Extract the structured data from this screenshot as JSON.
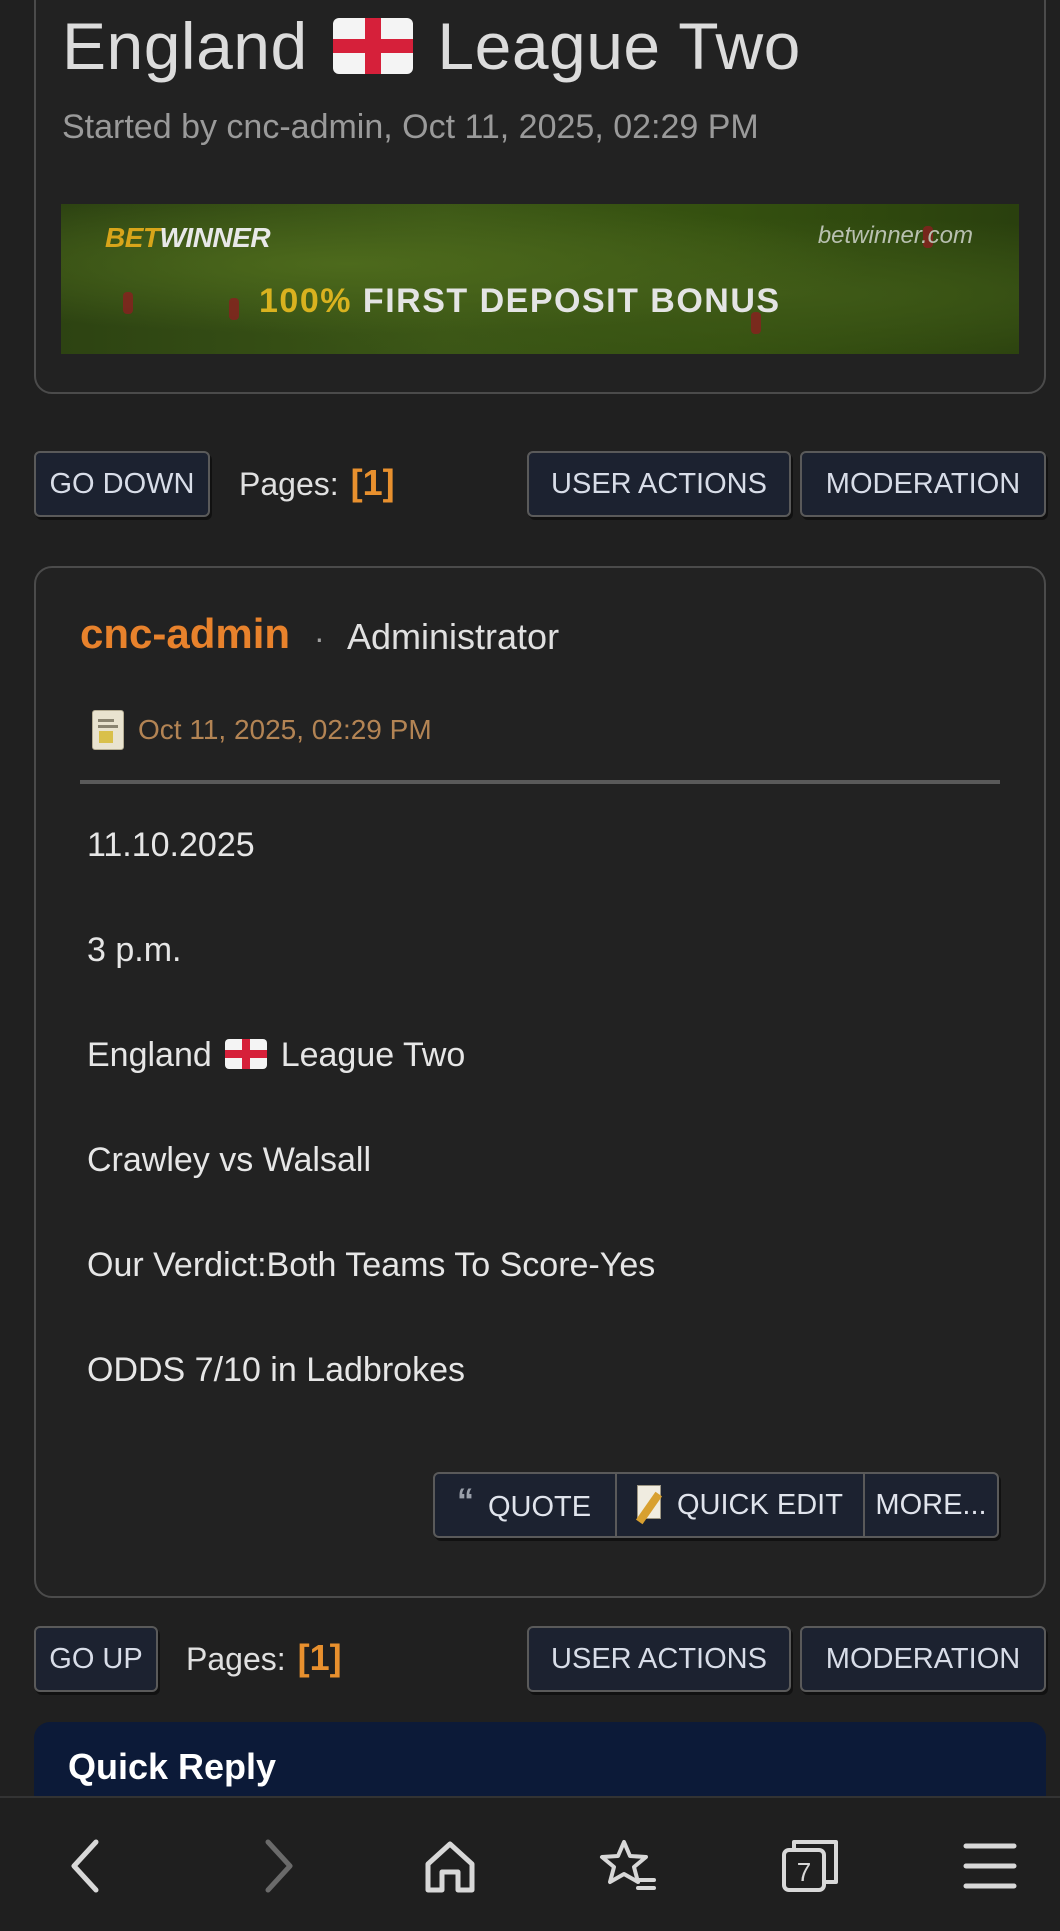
{
  "topic": {
    "title_prefix": "England",
    "title_suffix": "League Two",
    "meta": "Started by cnc-admin, Oct 11, 2025, 02:29 PM"
  },
  "banner": {
    "brand_bet": "BET",
    "brand_winner": "WINNER",
    "url": "betwinner.com",
    "bonus_pct": "100%",
    "bonus_text": "FIRST DEPOSIT BONUS"
  },
  "top_bar": {
    "go_down": "GO DOWN",
    "pages_label": "Pages:",
    "pages_value": "[1]",
    "user_actions": "USER ACTIONS",
    "moderation": "MODERATION"
  },
  "post": {
    "author": "cnc-admin",
    "separator": "·",
    "role": "Administrator",
    "date": "Oct 11, 2025, 02:29 PM",
    "line1": "11.10.2025",
    "line2": "3 p.m.",
    "line3_prefix": "England",
    "line3_suffix": "League Two",
    "line4": "Crawley vs Walsall",
    "line5": "Our Verdict:Both Teams To Score-Yes",
    "line6": "ODDS 7/10 in Ladbrokes",
    "quote_label": "QUOTE",
    "quick_edit_label": "QUICK EDIT",
    "more_label": "MORE..."
  },
  "bottom_bar": {
    "go_up": "GO UP",
    "pages_label": "Pages:",
    "pages_value": "[1]",
    "user_actions": "USER ACTIONS",
    "moderation": "MODERATION"
  },
  "quick_reply": {
    "title": "Quick Reply"
  },
  "browser_nav": {
    "tab_count": "7",
    "icons": [
      "back-icon",
      "forward-icon",
      "home-icon",
      "bookmarks-icon",
      "tabs-icon",
      "menu-icon"
    ]
  },
  "colors": {
    "background": "#202020",
    "accent_orange": "#e8822c",
    "button_bg": "#1c2230",
    "quick_reply_bg": "#0c1a38"
  }
}
